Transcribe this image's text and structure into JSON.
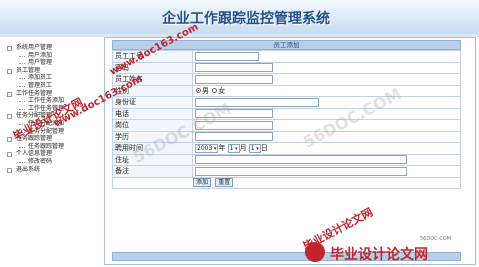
{
  "header": {
    "title": "企业工作跟踪监控管理系统"
  },
  "tree": [
    {
      "label": "系统用户管理",
      "level": 0
    },
    {
      "label": "用户添加",
      "level": 1
    },
    {
      "label": "用户管理",
      "level": 1
    },
    {
      "label": "员工管理",
      "level": 0
    },
    {
      "label": "添加员工",
      "level": 1
    },
    {
      "label": "管理员工",
      "level": 1
    },
    {
      "label": "工作任务管理",
      "level": 0
    },
    {
      "label": "工作任务添加",
      "level": 1
    },
    {
      "label": "工作任务管理",
      "level": 1
    },
    {
      "label": "任务分配管理",
      "level": 0
    },
    {
      "label": "任务分配添加",
      "level": 1
    },
    {
      "label": "任务分配管理",
      "level": 1
    },
    {
      "label": "任务跟踪管理",
      "level": 0
    },
    {
      "label": "任务跟踪管理",
      "level": 1
    },
    {
      "label": "个人信息管理",
      "level": 0
    },
    {
      "label": "修改密码",
      "level": 1
    },
    {
      "label": "退出系统",
      "level": 0
    }
  ],
  "form": {
    "heading": "员工添加",
    "fields": {
      "emp_no": {
        "label": "员工工号",
        "value": ""
      },
      "password": {
        "label": "密码",
        "value": ""
      },
      "name": {
        "label": "员工姓名",
        "value": ""
      },
      "gender": {
        "label": "性别",
        "options": [
          "男",
          "女"
        ],
        "selected": "男"
      },
      "id_card": {
        "label": "身份证",
        "value": ""
      },
      "phone": {
        "label": "电话",
        "value": ""
      },
      "position": {
        "label": "岗位",
        "value": ""
      },
      "education": {
        "label": "学历",
        "value": ""
      },
      "hire_date": {
        "label": "聘用时间",
        "year": "2003",
        "month": "1",
        "day": "1",
        "year_unit": "年",
        "month_unit": "月",
        "day_unit": "日"
      },
      "address": {
        "label": "住址",
        "value": ""
      },
      "remark": {
        "label": "备注",
        "value": ""
      }
    },
    "buttons": {
      "add": "添加",
      "reset": "重置"
    }
  },
  "watermarks": {
    "site1": "www.doc163.com",
    "site2": "www.doc163.com",
    "cn1": "毕业设计论文网",
    "cn2": "毕业设计论文网",
    "light1": "56DOC.COM",
    "light2": "56DOC.COM",
    "logo_domain": "56DOC.COM",
    "logo_text": "毕业设计论文网"
  }
}
